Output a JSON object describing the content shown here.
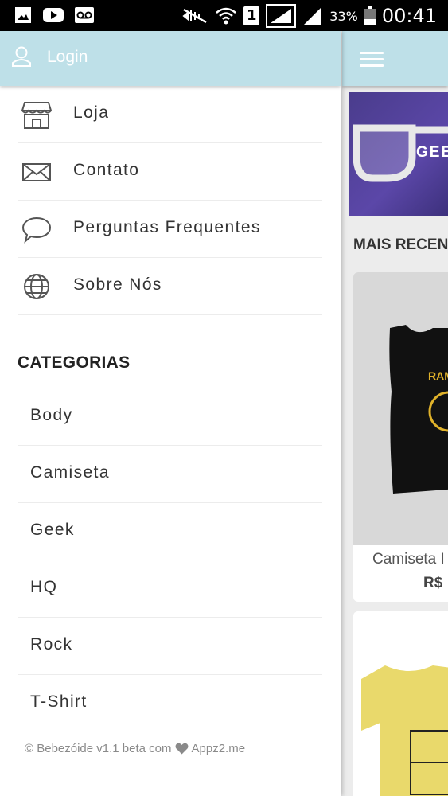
{
  "status_bar": {
    "battery": "33%",
    "clock": "00:41",
    "sim": "1",
    "icons": [
      "gallery-icon",
      "youtube-icon",
      "voicemail-icon",
      "mute-icon",
      "wifi-icon",
      "sim-icon",
      "signal-icon",
      "battery-icon"
    ]
  },
  "drawer": {
    "login_label": "Login",
    "menu": [
      {
        "label": "Loja",
        "icon": "store-icon"
      },
      {
        "label": "Contato",
        "icon": "envelope-icon"
      },
      {
        "label": "Perguntas Frequentes",
        "icon": "chat-bubble-icon"
      },
      {
        "label": "Sobre Nós",
        "icon": "globe-icon"
      }
    ],
    "categories_title": "CATEGORIAS",
    "categories": [
      "Body",
      "Camiseta",
      "Geek",
      "HQ",
      "Rock",
      "T-Shirt"
    ],
    "footer": {
      "prefix": "© Bebezóide v1.1 beta com",
      "suffix": "Appz2.me"
    }
  },
  "main": {
    "banner_text": "GEE",
    "section_title": "MAIS RECEN",
    "products": [
      {
        "name": "Camiseta I",
        "price": "R$"
      }
    ]
  },
  "colors": {
    "header_bg": "#bee0e8",
    "header_text": "#ffffff",
    "banner_bg": "#4a3c8c"
  }
}
